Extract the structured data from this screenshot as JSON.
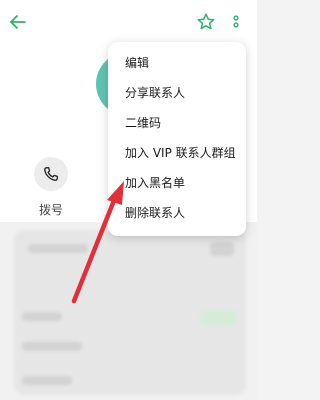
{
  "menu": {
    "items": [
      {
        "label": "编辑"
      },
      {
        "label": "分享联系人"
      },
      {
        "label": "二维码"
      },
      {
        "label": "加入 VIP 联系人群组"
      },
      {
        "label": "加入黑名单"
      },
      {
        "label": "删除联系人"
      }
    ]
  },
  "actions": {
    "call_label": "拨号"
  },
  "colors": {
    "accent": "#2db36b",
    "avatar": "#5fc4b3",
    "annotation_arrow": "#e0303a"
  },
  "icons": {
    "back": "back-arrow-icon",
    "favorite": "star-icon",
    "more": "more-vertical-icon",
    "call": "phone-icon"
  }
}
